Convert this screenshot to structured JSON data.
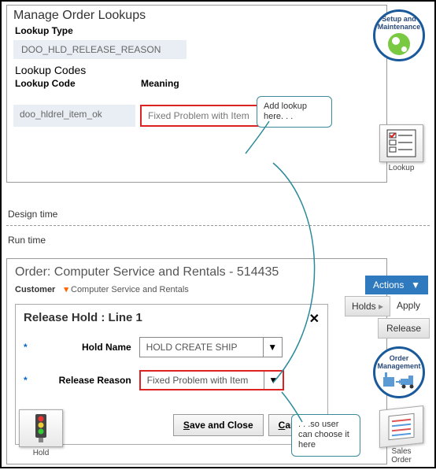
{
  "top": {
    "title": "Manage Order Lookups",
    "lookup_type_label": "Lookup Type",
    "lookup_type_value": "DOO_HLD_RELEASE_REASON",
    "codes_header": "Lookup Codes",
    "col_code": "Lookup Code",
    "col_meaning": "Meaning",
    "row_code": "doo_hldrel_item_ok",
    "row_meaning": "Fixed Problem with Item"
  },
  "callout1": "Add lookup here. . .",
  "callout2": ". . .so user can choose it here",
  "labels": {
    "design_time": "Design time",
    "run_time": "Run time"
  },
  "order": {
    "title": "Order: Computer Service and Rentals - 514435",
    "customer_label": "Customer",
    "customer_value": "Computer Service and Rentals"
  },
  "dialog": {
    "title": "Release Hold : Line 1",
    "hold_name_label": "Hold Name",
    "hold_name_value": "HOLD CREATE SHIP",
    "reason_label": "Release Reason",
    "reason_value": "Fixed Problem with Item",
    "save": "ave and Close",
    "save_u": "S",
    "cancel": "ancel",
    "cancel_u": "C"
  },
  "side": {
    "actions": "Actions",
    "holds": "Holds",
    "apply": "Apply",
    "release": "Release"
  },
  "badges": {
    "setup1": "Setup and",
    "setup2": "Maintenance",
    "om1": "Order",
    "om2": "Management"
  },
  "tiles": {
    "lookup": "Lookup",
    "hold": "Hold",
    "sales1": "Sales",
    "sales2": "Order"
  }
}
